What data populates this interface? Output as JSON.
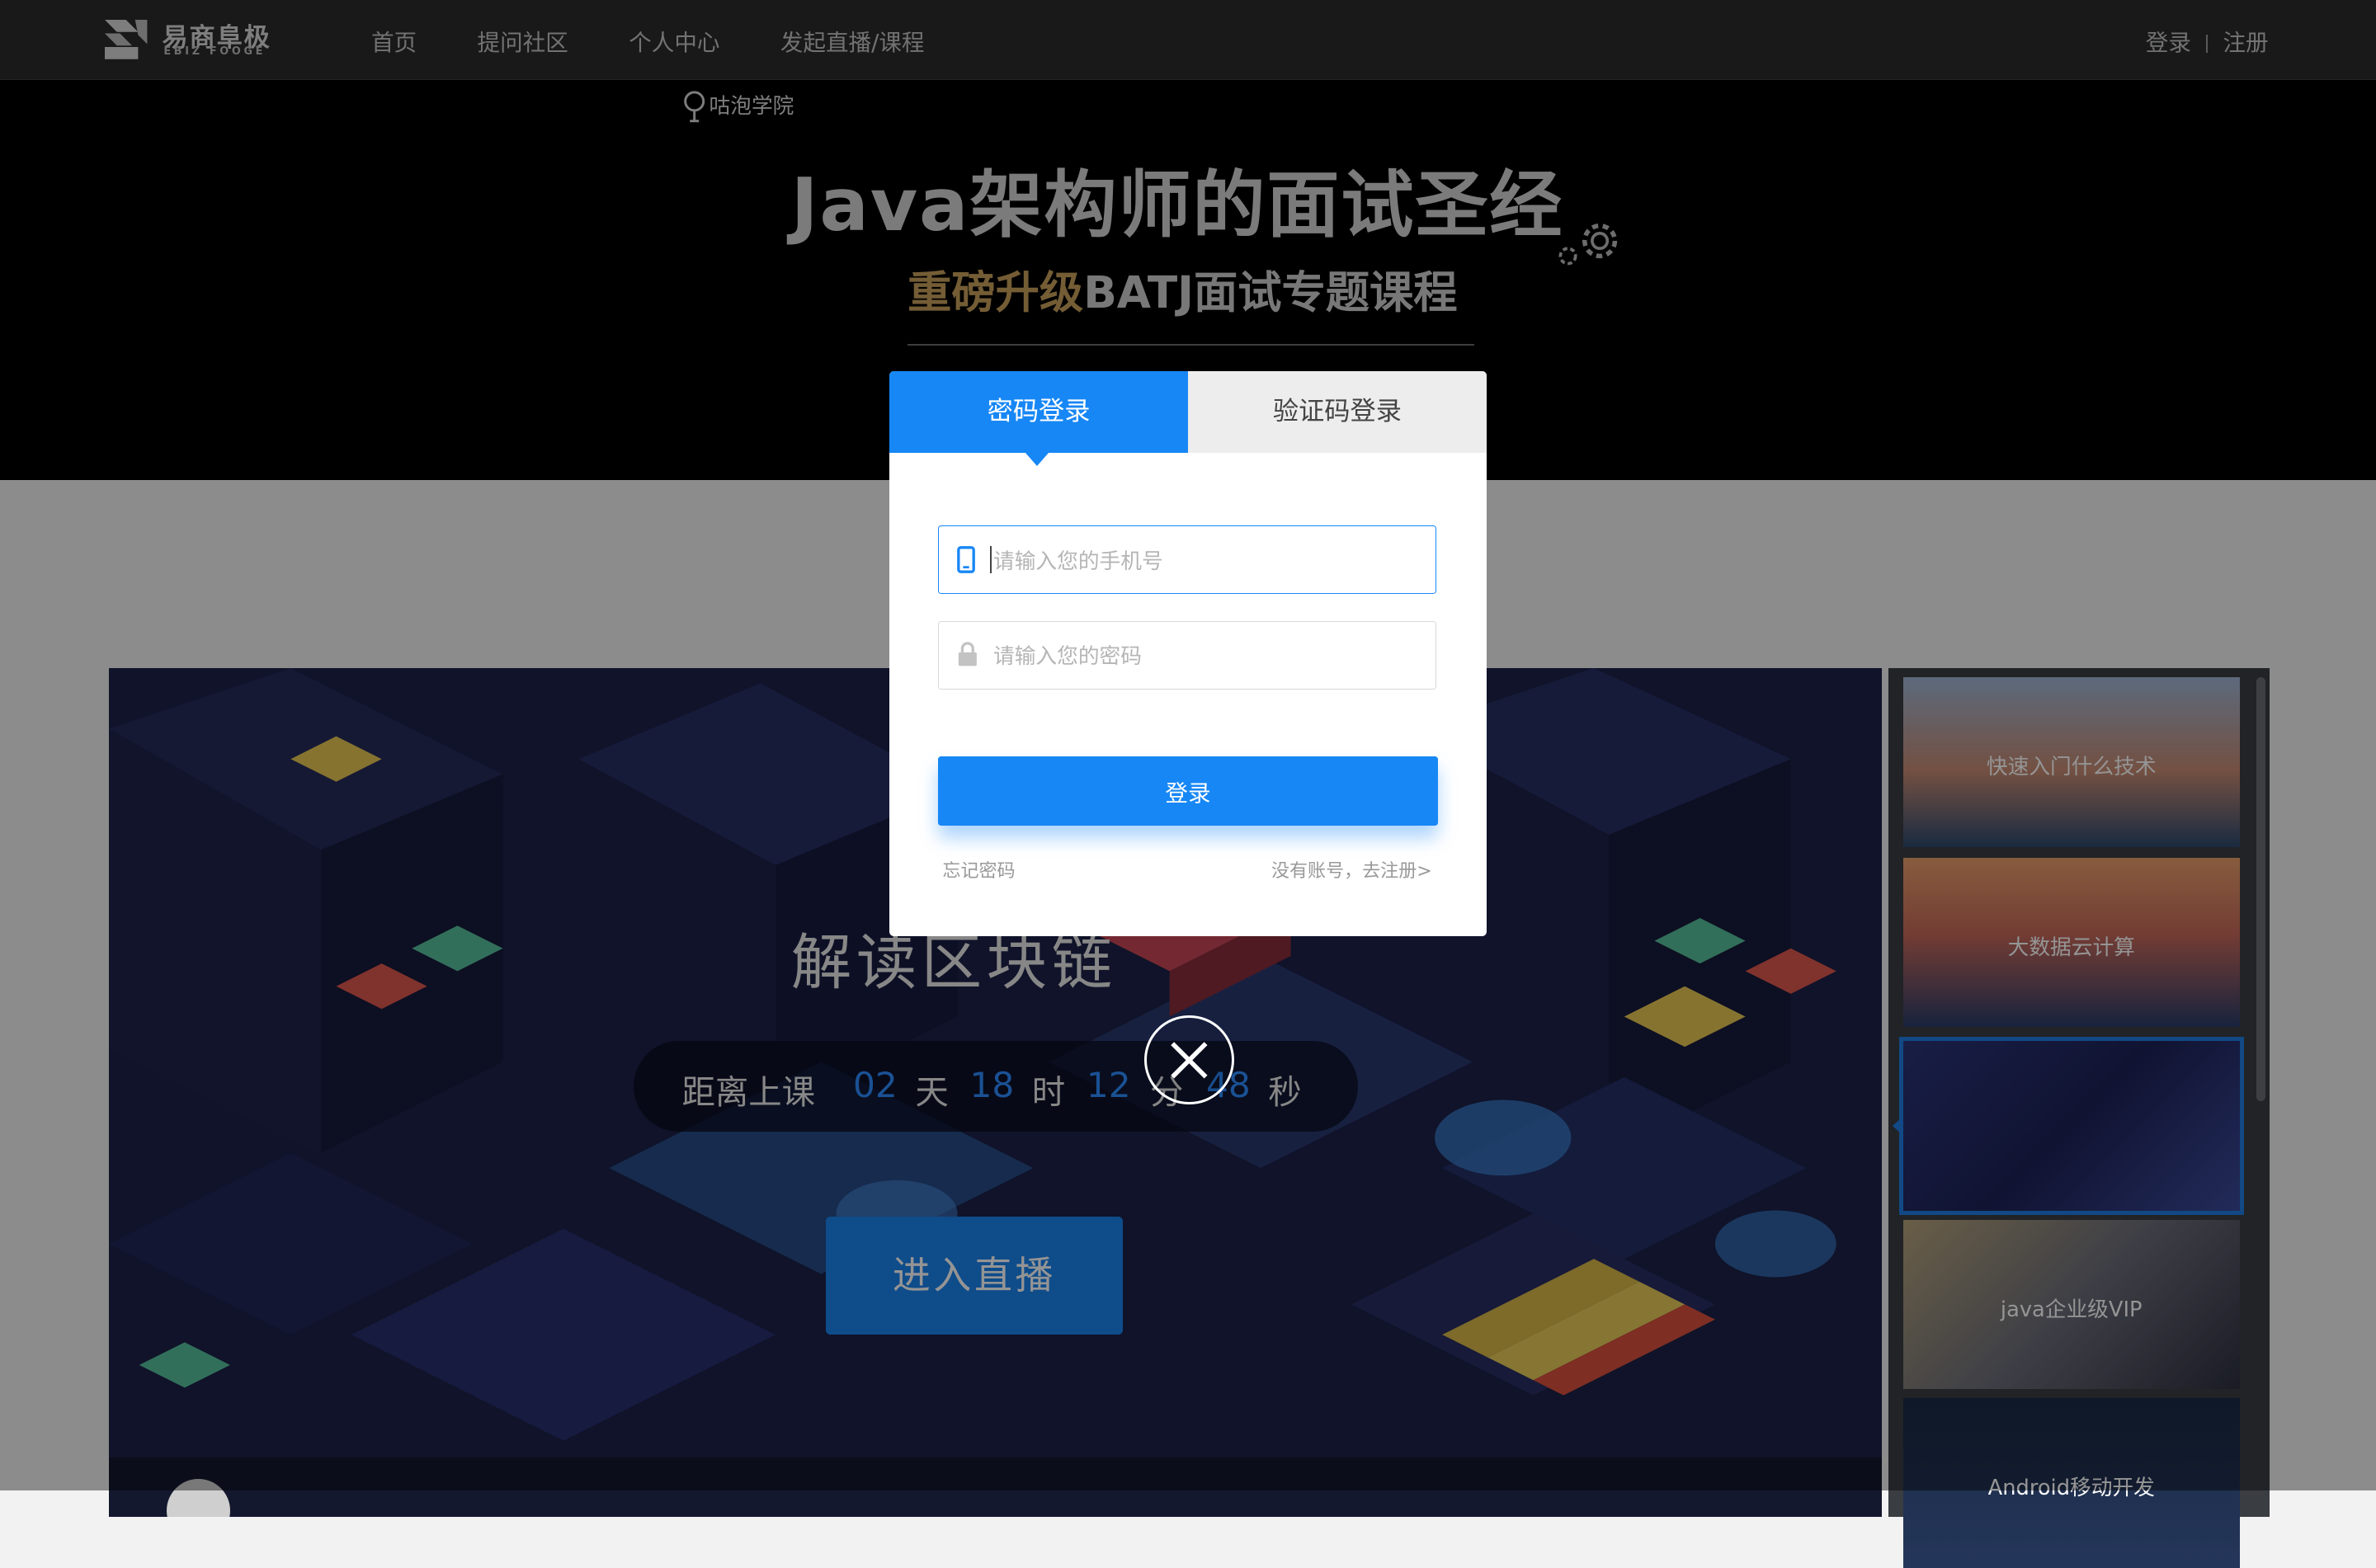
{
  "nav": {
    "logo_cn": "易商阜极",
    "logo_en": "EBIZ FOOGE",
    "items": [
      "首页",
      "提问社区",
      "个人中心",
      "发起直播/课程"
    ],
    "login": "登录",
    "register": "注册"
  },
  "banner": {
    "brand": "咕泡学院",
    "title": "Java架构师的面试圣经",
    "subtitle_gold": "重磅升级",
    "subtitle_rest": "BATJ面试专题课程"
  },
  "player": {
    "course_title": "解读区块链",
    "countdown": {
      "prefix": "距离上课",
      "days": "02",
      "days_unit": "天",
      "hours": "18",
      "hours_unit": "时",
      "minutes": "12",
      "minutes_unit": "分",
      "seconds": "48",
      "seconds_unit": "秒"
    },
    "enter_button": "进入直播"
  },
  "sidebar": {
    "items": [
      {
        "label": "快速入门什么技术"
      },
      {
        "label": "大数据云计算"
      },
      {
        "label": ""
      },
      {
        "label": "java企业级VIP"
      },
      {
        "label": "Android移动开发"
      }
    ]
  },
  "modal": {
    "tab_password": "密码登录",
    "tab_code": "验证码登录",
    "phone_placeholder": "请输入您的手机号",
    "password_placeholder": "请输入您的密码",
    "login_button": "登录",
    "forgot": "忘记密码",
    "register_link": "没有账号，去注册>"
  },
  "colors": {
    "accent": "#1787f5",
    "nav_bg": "#2b2c2e",
    "countdown_number": "#2e8cff",
    "banner_gold": "#c8a15c"
  },
  "icons": [
    "logo-mark-icon",
    "bulb-icon",
    "gear-icon",
    "phone-icon",
    "lock-icon",
    "close-icon"
  ]
}
